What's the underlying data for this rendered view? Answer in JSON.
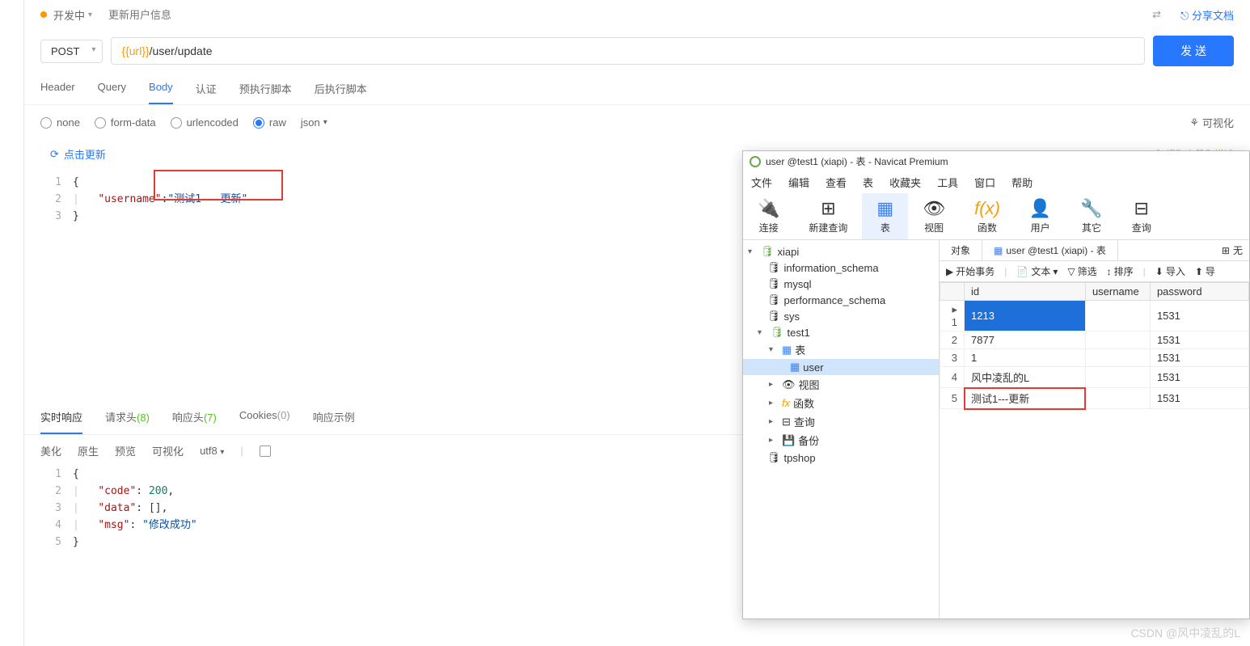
{
  "topbar": {
    "status_label": "开发中",
    "title_placeholder": "更新用户信息",
    "share_label": "分享文档"
  },
  "request": {
    "method": "POST",
    "url_var": "{{url}}",
    "url_path": "/user/update",
    "send_label": "发 送"
  },
  "tabs": {
    "header": "Header",
    "query": "Query",
    "body": "Body",
    "auth": "认证",
    "pre": "预执行脚本",
    "post": "后执行脚本"
  },
  "body_opts": {
    "none": "none",
    "form": "form-data",
    "urlenc": "urlencoded",
    "raw": "raw",
    "content_type": "json",
    "visual": "可视化"
  },
  "editor": {
    "update_hint": "点击更新",
    "extract_hint": "提取字段和描述",
    "lines": {
      "l1": "{",
      "l2_key": "\"username\"",
      "l2_val": "\"测试1---更新\"",
      "l3": "}"
    }
  },
  "response": {
    "tabs": {
      "realtime": "实时响应",
      "req_headers": "请求头",
      "req_count": "(8)",
      "resp_headers": "响应头",
      "resp_count": "(7)",
      "cookies": "Cookies",
      "cookies_count": "(0)",
      "examples": "响应示例"
    },
    "toolbar": {
      "beautify": "美化",
      "raw": "原生",
      "preview": "预览",
      "visual": "可视化",
      "charset": "utf8"
    },
    "json": {
      "l1": "{",
      "l2_key": "\"code\"",
      "l2_val": "200",
      "l3_key": "\"data\"",
      "l3_val": "[]",
      "l4_key": "\"msg\"",
      "l4_val": "\"修改成功\"",
      "l5": "}"
    }
  },
  "navicat": {
    "title": "user @test1 (xiapi) - 表 - Navicat Premium",
    "menu": [
      "文件",
      "编辑",
      "查看",
      "表",
      "收藏夹",
      "工具",
      "窗口",
      "帮助"
    ],
    "toolbar": [
      "连接",
      "新建查询",
      "表",
      "视图",
      "函数",
      "用户",
      "其它",
      "查询"
    ],
    "tree": {
      "xiapi": "xiapi",
      "information_schema": "information_schema",
      "mysql": "mysql",
      "performance_schema": "performance_schema",
      "sys": "sys",
      "test1": "test1",
      "table_node": "表",
      "user": "user",
      "view": "视图",
      "func": "函数",
      "query": "查询",
      "backup": "备份",
      "tpshop": "tpshop"
    },
    "right_tabs": {
      "objects": "对象",
      "tab_title": "user @test1 (xiapi) - 表",
      "no": "无"
    },
    "right_toolbar": {
      "begin": "开始事务",
      "text": "文本",
      "filter": "筛选",
      "sort": "排序",
      "import": "导入",
      "export": "导"
    },
    "columns": [
      "id",
      "username",
      "password"
    ],
    "rows": [
      {
        "n": "1",
        "id": "1213",
        "username": "",
        "password": "1531"
      },
      {
        "n": "2",
        "id": "7877",
        "username": "",
        "password": "1531"
      },
      {
        "n": "3",
        "id": "1",
        "username": "",
        "password": "1531"
      },
      {
        "n": "4",
        "id": "风中凌乱的L",
        "username": "",
        "password": "1531"
      },
      {
        "n": "5",
        "id": "测试1---更新",
        "username": "",
        "password": "1531"
      }
    ]
  },
  "watermark": "CSDN @风中凌乱的L"
}
